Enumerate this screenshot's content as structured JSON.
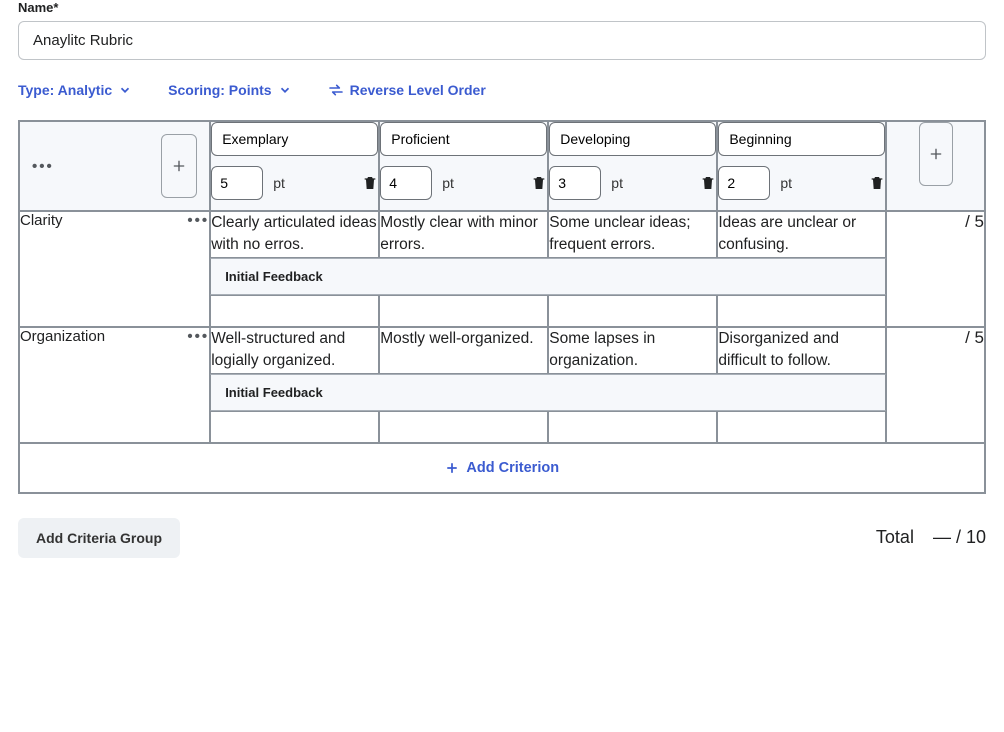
{
  "nameField": {
    "label": "Name*",
    "value": "Anaylitc Rubric"
  },
  "controls": {
    "type": "Type: Analytic",
    "scoring": "Scoring: Points",
    "reverse": "Reverse Level Order"
  },
  "levels": [
    {
      "name": "Exemplary",
      "points": "5",
      "unit": "pt"
    },
    {
      "name": "Proficient",
      "points": "4",
      "unit": "pt"
    },
    {
      "name": "Developing",
      "points": "3",
      "unit": "pt"
    },
    {
      "name": "Beginning",
      "points": "2",
      "unit": "pt"
    }
  ],
  "criteria": [
    {
      "name": "Clarity",
      "descriptions": [
        "Clearly articulated ideas with no erros.",
        "Mostly clear with minor errors.",
        "Some unclear ideas; frequent errors.",
        "Ideas are unclear or confusing."
      ],
      "outOf": "/ 5",
      "feedbackLabel": "Initial Feedback"
    },
    {
      "name": "Organization",
      "descriptions": [
        "Well-structured and logially organized.",
        "Mostly well-organized.",
        "Some lapses in organization.",
        "Disorganized and difficult to follow."
      ],
      "outOf": "/ 5",
      "feedbackLabel": "Initial Feedback"
    }
  ],
  "addCriterion": "Add Criterion",
  "addCriteriaGroup": "Add Criteria Group",
  "total": {
    "label": "Total",
    "value": "— / 10"
  }
}
